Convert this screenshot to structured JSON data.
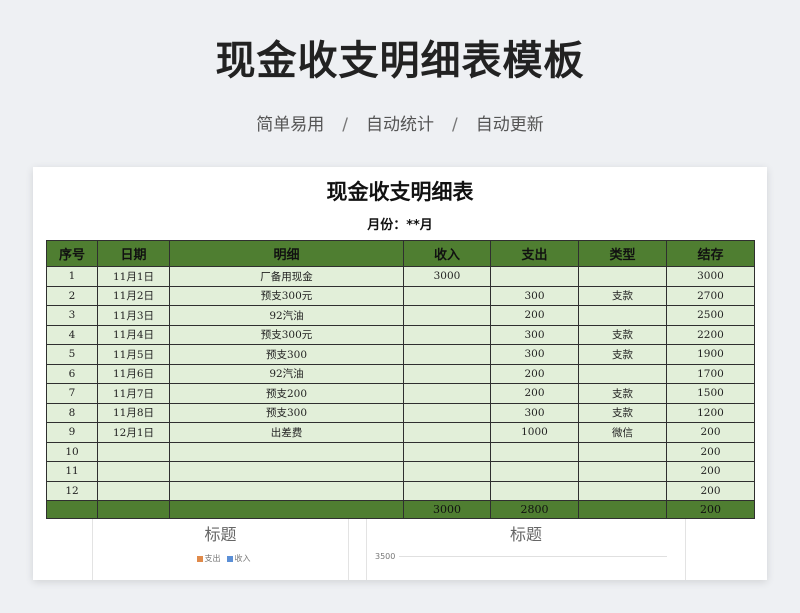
{
  "page": {
    "title": "现金收支明细表模板",
    "subtitle_items": [
      "简单易用",
      "自动统计",
      "自动更新"
    ],
    "separator": "/"
  },
  "sheet": {
    "title": "现金收支明细表",
    "month_label": "月份：**月",
    "columns": [
      "序号",
      "日期",
      "明细",
      "收入",
      "支出",
      "类型",
      "结存"
    ],
    "rows": [
      [
        "1",
        "11月1日",
        "厂备用现金",
        "3000",
        "",
        "",
        "3000"
      ],
      [
        "2",
        "11月2日",
        "预支300元",
        "",
        "300",
        "支款",
        "2700"
      ],
      [
        "3",
        "11月3日",
        "92汽油",
        "",
        "200",
        "",
        "2500"
      ],
      [
        "4",
        "11月4日",
        "预支300元",
        "",
        "300",
        "支款",
        "2200"
      ],
      [
        "5",
        "11月5日",
        "预支300",
        "",
        "300",
        "支款",
        "1900"
      ],
      [
        "6",
        "11月6日",
        "92汽油",
        "",
        "200",
        "",
        "1700"
      ],
      [
        "7",
        "11月7日",
        "预支200",
        "",
        "200",
        "支款",
        "1500"
      ],
      [
        "8",
        "11月8日",
        "预支300",
        "",
        "300",
        "支款",
        "1200"
      ],
      [
        "9",
        "12月1日",
        "出差费",
        "",
        "1000",
        "微信",
        "200"
      ],
      [
        "10",
        "",
        "",
        "",
        "",
        "",
        "200"
      ],
      [
        "11",
        "",
        "",
        "",
        "",
        "",
        "200"
      ],
      [
        "12",
        "",
        "",
        "",
        "",
        "",
        "200"
      ]
    ],
    "totals": [
      "",
      "",
      "",
      "3000",
      "2800",
      "",
      "200"
    ]
  },
  "charts": {
    "left": {
      "title": "标题",
      "legend": [
        {
          "name": "支出",
          "color": "#e08a4a"
        },
        {
          "name": "收入",
          "color": "#5b8fd6"
        }
      ]
    },
    "right": {
      "title": "标题",
      "axis_top": "3500"
    }
  }
}
